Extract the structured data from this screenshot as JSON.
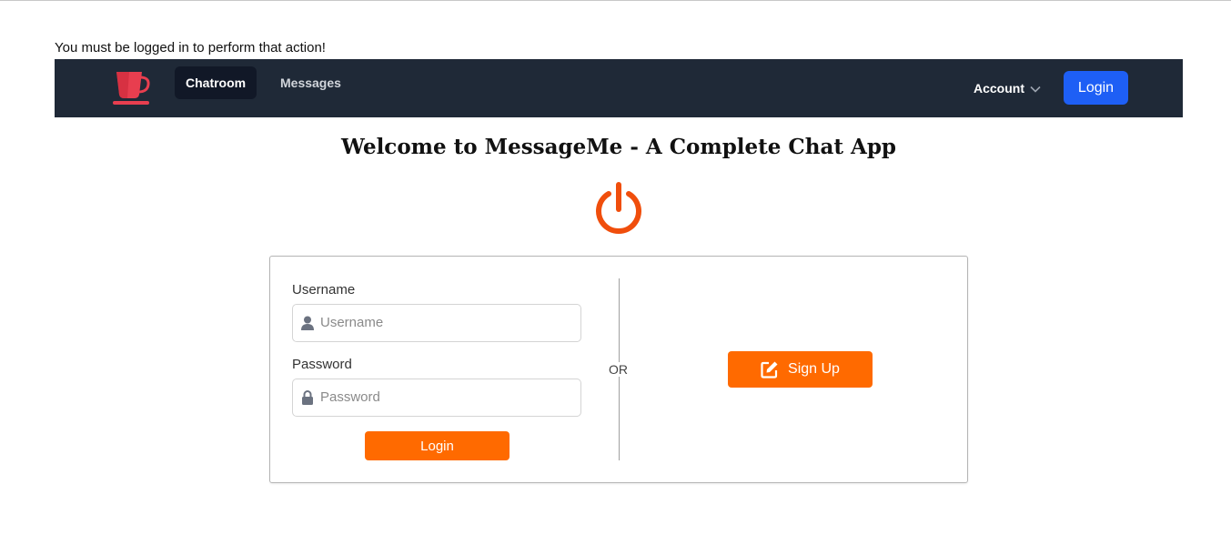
{
  "flash": {
    "message": "You must be logged in to perform that action!"
  },
  "navbar": {
    "logo_icon": "coffee-cup-icon",
    "tabs": [
      {
        "label": "Chatroom",
        "active": true
      },
      {
        "label": "Messages",
        "active": false
      }
    ],
    "account_label": "Account",
    "account_icon": "chevron-down-icon",
    "login_label": "Login"
  },
  "main": {
    "title": "Welcome to MessageMe - A Complete Chat App",
    "hero_icon": "power-icon"
  },
  "login_form": {
    "username_label": "Username",
    "username_placeholder": "Username",
    "username_icon": "user-icon",
    "password_label": "Password",
    "password_placeholder": "Password",
    "password_icon": "lock-icon",
    "submit_label": "Login"
  },
  "divider_text": "OR",
  "signup": {
    "label": "Sign Up",
    "icon": "edit-icon"
  },
  "colors": {
    "navbar_bg": "#1f2937",
    "nav_login_bg": "#1e5ff5",
    "accent_orange": "#ff6a00",
    "power_icon": "#f04e0c",
    "logo_red": "#e83e4f"
  }
}
